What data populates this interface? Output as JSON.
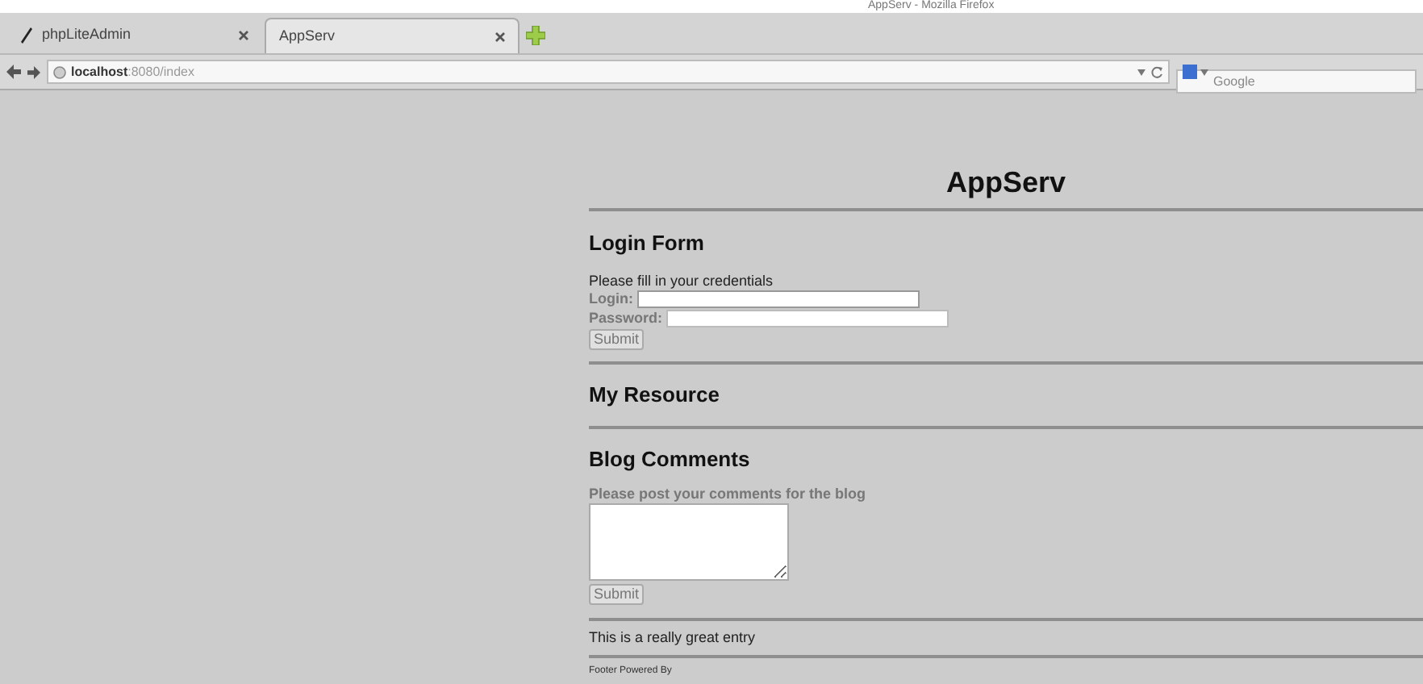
{
  "window": {
    "title": "AppServ - Mozilla Firefox"
  },
  "tabs": [
    {
      "label": "phpLiteAdmin",
      "selected": false
    },
    {
      "label": "AppServ",
      "selected": true
    }
  ],
  "address_bar": {
    "host": "localhost",
    "path": ":8080/index"
  },
  "search": {
    "placeholder": "Google"
  },
  "page": {
    "title": "AppServ",
    "login": {
      "heading": "Login Form",
      "intro": "Please fill in your credentials",
      "login_label": "Login:",
      "password_label": "Password:",
      "submit": "Submit"
    },
    "resource": {
      "heading": "My Resource"
    },
    "blog": {
      "heading": "Blog Comments",
      "prompt": "Please post your comments for the blog",
      "submit": "Submit"
    },
    "entry": "This is a really great entry",
    "footer": "Footer Powered By"
  }
}
